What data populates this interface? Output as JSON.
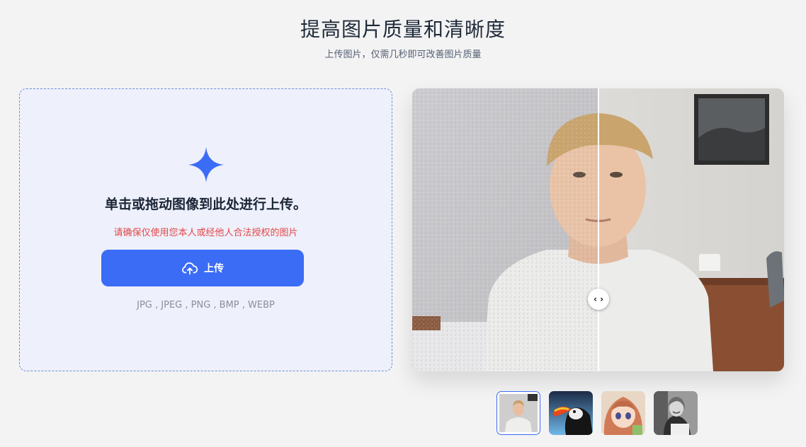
{
  "header": {
    "title": "提高图片质量和清晰度",
    "subtitle": "上传图片，仅需几秒即可改善图片质量"
  },
  "upload": {
    "prompt": "单击或拖动图像到此处进行上传。",
    "warning": "请确保仅使用您本人或经他人合法授权的图片",
    "button_label": "上传",
    "formats": "JPG , JPEG , PNG , BMP , WEBP",
    "icons": {
      "sparkle": "sparkle-icon",
      "upload": "cloud-upload-icon"
    }
  },
  "compare": {
    "handle_icon": "left-right-arrows-icon",
    "handle_glyph": "‹ ›"
  },
  "samples": [
    {
      "name": "young man portrait",
      "selected": true
    },
    {
      "name": "puffin bird",
      "selected": false
    },
    {
      "name": "anime girl",
      "selected": false
    },
    {
      "name": "smiling woman black and white",
      "selected": false
    }
  ],
  "colors": {
    "accent": "#3b6cf6",
    "warning": "#e24848",
    "upload_bg": "#eef0fb",
    "page_bg": "#f3f3f3"
  }
}
